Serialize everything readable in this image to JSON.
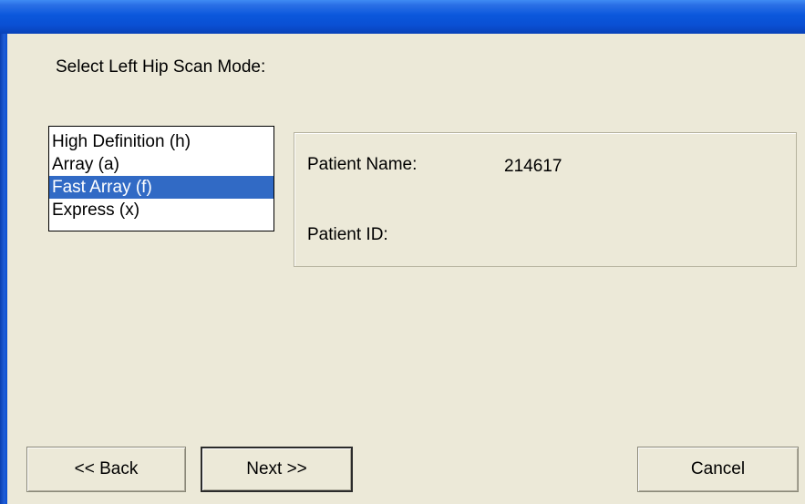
{
  "dialog": {
    "prompt": "Select Left Hip Scan Mode:"
  },
  "scan_modes": {
    "items": [
      {
        "label": "High Definition (h)",
        "selected": false
      },
      {
        "label": "Array (a)",
        "selected": false
      },
      {
        "label": "Fast Array (f)",
        "selected": true
      },
      {
        "label": "Express (x)",
        "selected": false
      }
    ]
  },
  "patient": {
    "name_label": "Patient Name:",
    "name_value": "214617",
    "id_label": "Patient ID:",
    "id_value": ""
  },
  "buttons": {
    "back": "<< Back",
    "next": "Next >>",
    "cancel": "Cancel"
  },
  "colors": {
    "selection": "#316ac5",
    "title_bar": "#0a4fd3",
    "dialog_background": "#ece9d8"
  }
}
